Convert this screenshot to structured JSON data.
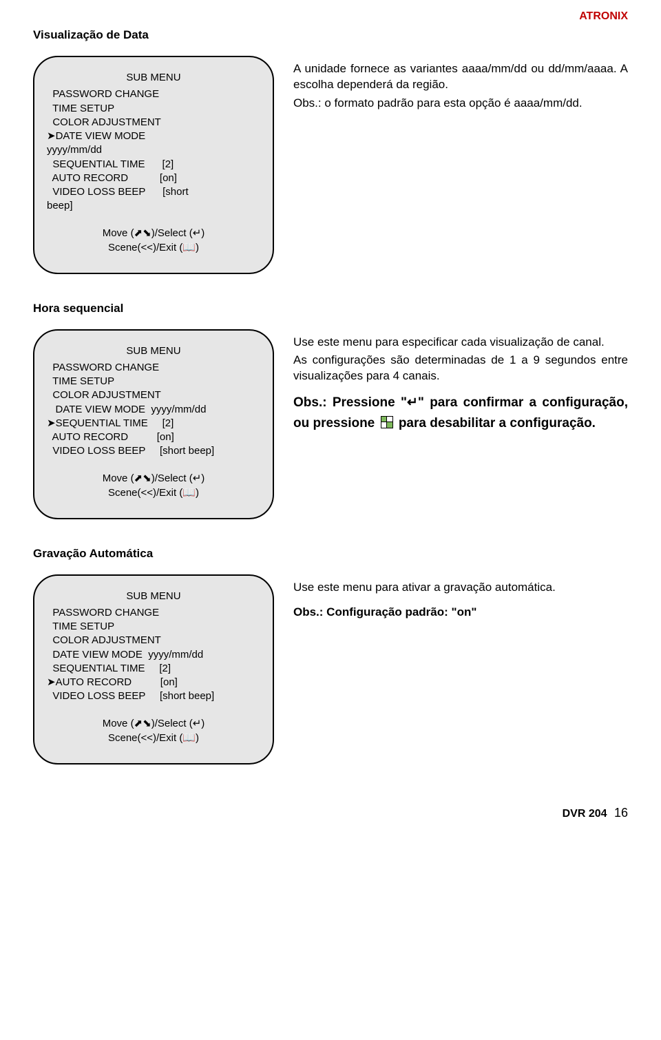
{
  "brand": "ATRONIX",
  "sections": {
    "s1": {
      "title": "Visualização de Data",
      "panel": {
        "menu_title": "SUB MENU",
        "l1": "  PASSWORD CHANGE",
        "l2": "  TIME SETUP",
        "l3": "  COLOR ADJUSTMENT",
        "l4": "➤DATE VIEW MODE",
        "l5": "yyyy/mm/dd",
        "l6": "  SEQUENTIAL TIME      [2]",
        "l7": "  AUTO RECORD           [on]",
        "l8": "  VIDEO LOSS BEEP      [short",
        "l9": "beep]",
        "nav1": "Move (⬈⬊)/Select (↵)",
        "nav2": "Scene(<<)/Exit (📖)"
      },
      "desc": {
        "p1": "A unidade fornece as variantes aaaa/mm/dd    ou dd/mm/aaaa. A escolha dependerá da região.",
        "p2": "Obs.: o formato padrão para esta opção é aaaa/mm/dd."
      }
    },
    "s2": {
      "title": "Hora sequencial",
      "panel": {
        "menu_title": "SUB MENU",
        "l1": "  PASSWORD CHANGE",
        "l2": "  TIME SETUP",
        "l3": "  COLOR ADJUSTMENT",
        "l4": "   DATE VIEW MODE  yyyy/mm/dd",
        "l5": "➤SEQUENTIAL TIME     [2]",
        "l6": "  AUTO RECORD          [on]",
        "l7": "  VIDEO LOSS BEEP     [short beep]",
        "nav1": "Move (⬈⬊)/Select (↵)",
        "nav2": "Scene(<<)/Exit (📖)"
      },
      "desc": {
        "p1": "Use este menu para especificar cada visualização de canal.",
        "p2": "As configurações são determinadas de 1 a 9 segundos entre visualizações para 4 canais.",
        "obs_a": "Obs.: Pressione \"↵\" para confirmar a configuração, ou pressione ",
        "obs_b": " para desabilitar a configuração."
      }
    },
    "s3": {
      "title": "Gravação Automática",
      "panel": {
        "menu_title": "SUB MENU",
        "l1": "  PASSWORD CHANGE",
        "l2": "  TIME SETUP",
        "l3": "  COLOR ADJUSTMENT",
        "l4": "  DATE VIEW MODE  yyyy/mm/dd",
        "l5": "  SEQUENTIAL TIME     [2]",
        "l6": "➤AUTO RECORD          [on]",
        "l7": "  VIDEO LOSS BEEP     [short beep]",
        "nav1": "Move (⬈⬊)/Select (↵)",
        "nav2": "Scene(<<)/Exit (📖)"
      },
      "desc": {
        "p1": "Use este menu para ativar a gravação automática.",
        "p2": "Obs.: Configuração padrão: \"on\""
      }
    }
  },
  "footer": {
    "model": "DVR 204",
    "page": "16"
  }
}
